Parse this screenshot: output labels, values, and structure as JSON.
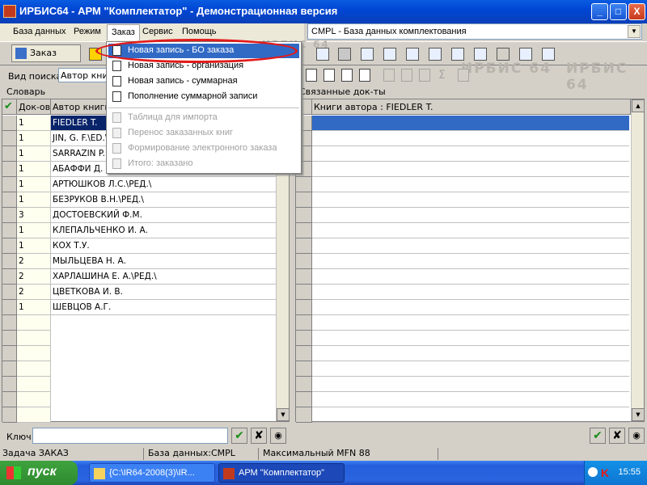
{
  "window": {
    "title": "ИРБИС64 - АРМ \"Комплектатор\" - Демонстрационная версия",
    "buttons": [
      "_",
      "□",
      "X"
    ]
  },
  "menubar": {
    "items": [
      "База данных",
      "Режим",
      "Заказ",
      "Сервис",
      "Помощь"
    ]
  },
  "db_select": {
    "value": "CMPL - База данных комплектования"
  },
  "toolbar": {
    "order_button": "Заказ",
    "watermark": "ИРБИС 64"
  },
  "search": {
    "label": "Вид поиска",
    "value": "Автор книги"
  },
  "sections": {
    "left": "Словарь",
    "right": "Связанные док-ты"
  },
  "left_grid": {
    "headers": [
      "Док-ов",
      "Автор книги"
    ],
    "rows": [
      {
        "count": "1",
        "author": "FIEDLER T."
      },
      {
        "count": "1",
        "author": "JIN, G. F.\\ED.\\"
      },
      {
        "count": "1",
        "author": "SARRAZIN P."
      },
      {
        "count": "1",
        "author": "АБАФФИ Д."
      },
      {
        "count": "1",
        "author": "АРТЮШКОВ Л.С.\\РЕД.\\"
      },
      {
        "count": "1",
        "author": "БЕЗРУКОВ В.Н.\\РЕД.\\"
      },
      {
        "count": "3",
        "author": "ДОСТОЕВСКИЙ Ф.М."
      },
      {
        "count": "1",
        "author": "КЛЕПАЛЬЧЕНКО И. А."
      },
      {
        "count": "1",
        "author": "КОХ Т.У."
      },
      {
        "count": "2",
        "author": "МЫЛЬЦЕВА Н. А."
      },
      {
        "count": "2",
        "author": "ХАРЛАШИНА Е. А.\\РЕД.\\"
      },
      {
        "count": "2",
        "author": "ЦВЕТКОВА И. В."
      },
      {
        "count": "1",
        "author": "ШЕВЦОВ А.Г."
      }
    ]
  },
  "right_grid": {
    "header": "Книги автора : FIEDLER T."
  },
  "key": {
    "label": "Ключ:"
  },
  "status": {
    "task": "Задача ЗАКАЗ",
    "db": "База данных:CMPL",
    "mfn": "Максимальный MFN 88"
  },
  "dropdown_menu": {
    "items": [
      {
        "label": "Новая запись - БО заказа",
        "enabled": true,
        "highlighted": true
      },
      {
        "label": "Новая запись - организация",
        "enabled": true
      },
      {
        "label": "Новая запись - суммарная",
        "enabled": true
      },
      {
        "label": "Пополнение суммарной записи",
        "enabled": true
      },
      {
        "label": "Таблица для импорта",
        "enabled": false
      },
      {
        "label": "Перенос заказанных книг",
        "enabled": false
      },
      {
        "label": "Формирование электронного заказа",
        "enabled": false
      },
      {
        "label": "Итого: заказано",
        "enabled": false
      }
    ]
  },
  "taskbar": {
    "start": "пуск",
    "items": [
      "{C:\\IR64-2008(3)\\IR...",
      "АРМ \"Комплектатор\""
    ],
    "clock": "15:55"
  },
  "colors": {
    "titlebar": "#0046d5",
    "selection": "#316ac5",
    "highlight_ellipse": "#e21a1a",
    "count_column_bg": "#fffff0"
  }
}
